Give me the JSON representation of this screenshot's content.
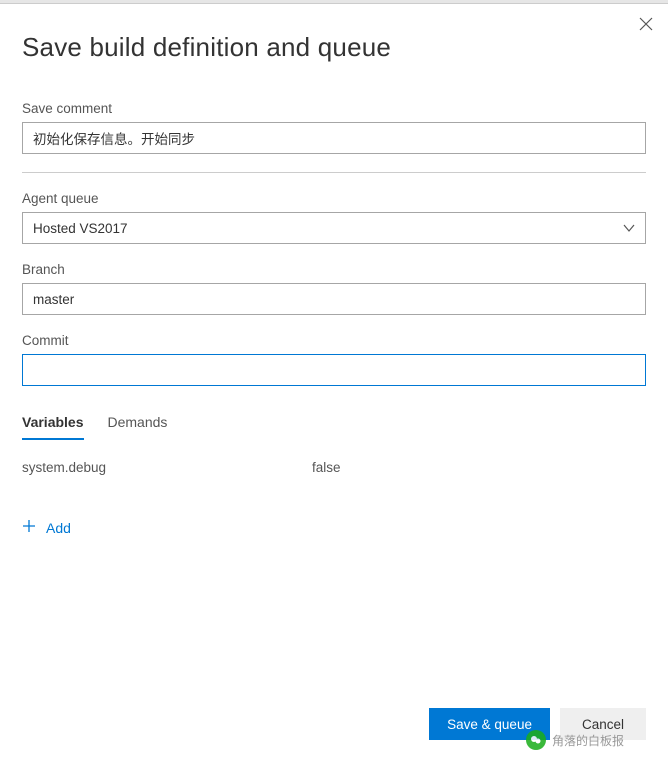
{
  "dialog": {
    "title": "Save build definition and queue"
  },
  "fields": {
    "save_comment": {
      "label": "Save comment",
      "value": "初始化保存信息。开始同步"
    },
    "agent_queue": {
      "label": "Agent queue",
      "value": "Hosted VS2017"
    },
    "branch": {
      "label": "Branch",
      "value": "master"
    },
    "commit": {
      "label": "Commit",
      "value": ""
    }
  },
  "tabs": {
    "variables": "Variables",
    "demands": "Demands"
  },
  "variables": [
    {
      "name": "system.debug",
      "value": "false"
    }
  ],
  "add_label": "Add",
  "buttons": {
    "save_queue": "Save & queue",
    "cancel": "Cancel"
  },
  "watermark": "角落的白板报"
}
